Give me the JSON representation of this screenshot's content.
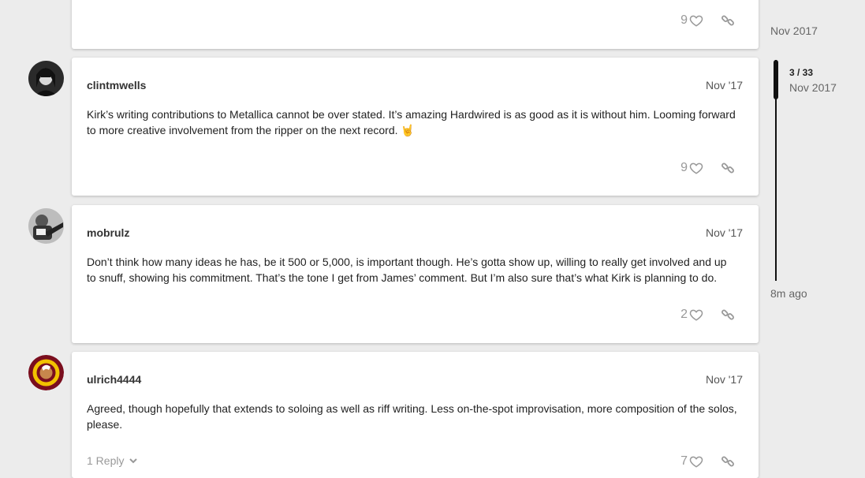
{
  "posts": [
    {
      "username": "",
      "date": "",
      "body": "",
      "likes": "9"
    },
    {
      "username": "clintmwells",
      "date": "Nov '17",
      "body": "Kirk’s writing contributions to Metallica cannot be over stated. It’s amazing Hardwired is as good as it is without him. Looming forward to more creative involvement from the ripper on the next record.",
      "emoji": "🤘",
      "likes": "9"
    },
    {
      "username": "mobrulz",
      "date": "Nov '17",
      "body": "Don’t think how many ideas he has, be it 500 or 5,000, is important though. He’s gotta show up, willing to really get involved and up to snuff, showing his commitment. That’s the tone I get from James’ comment. But I’m also sure that’s what Kirk is planning to do.",
      "likes": "2"
    },
    {
      "username": "ulrich4444",
      "date": "Nov '17",
      "body": "Agreed, though hopefully that extends to soloing as well as riff writing. Less on-the-spot improvisation, more composition of the solos, please.",
      "likes": "7",
      "reply_label": "1 Reply"
    }
  ],
  "timeline": {
    "top_date": "Nov 2017",
    "position": "3 / 33",
    "position_date": "Nov 2017",
    "bottom_label": "8m ago"
  },
  "icons": {
    "like": "heart-icon",
    "share": "link-icon",
    "expand": "chevron-down-icon"
  }
}
